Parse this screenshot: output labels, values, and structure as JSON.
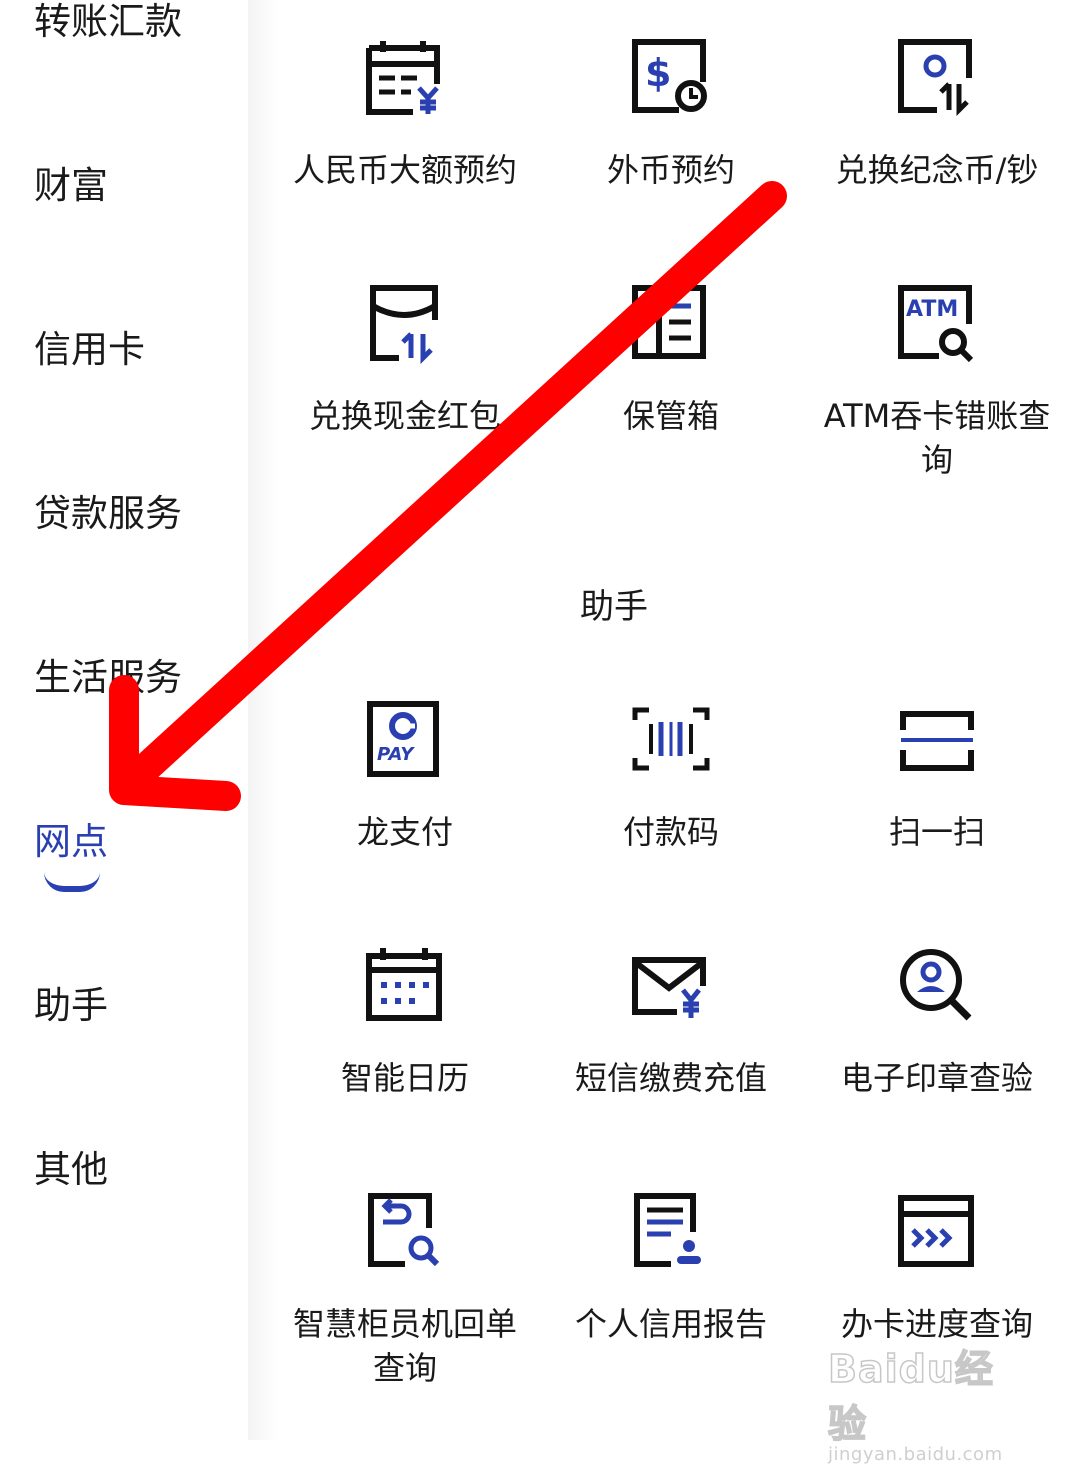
{
  "sidebar": {
    "items": [
      {
        "label": "转账汇款"
      },
      {
        "label": "财富"
      },
      {
        "label": "信用卡"
      },
      {
        "label": "贷款服务"
      },
      {
        "label": "生活服务"
      },
      {
        "label": "网点",
        "active": true
      },
      {
        "label": "助手"
      },
      {
        "label": "其他"
      }
    ]
  },
  "main": {
    "section_title": "助手",
    "tiles": [
      {
        "label": "人民币大额预约",
        "icon": "calendar-yuan-icon"
      },
      {
        "label": "外币预约",
        "icon": "dollar-clock-icon"
      },
      {
        "label": "兑换纪念币/钞",
        "icon": "coin-exchange-icon"
      },
      {
        "label": "兑换现金红包",
        "icon": "red-envelope-exchange-icon"
      },
      {
        "label": "保管箱",
        "icon": "safe-box-icon"
      },
      {
        "label": "ATM吞卡错账查询",
        "icon": "atm-search-icon"
      },
      {
        "label": "龙支付",
        "icon": "ccb-pay-icon"
      },
      {
        "label": "付款码",
        "icon": "barcode-icon"
      },
      {
        "label": "扫一扫",
        "icon": "scan-icon"
      },
      {
        "label": "智能日历",
        "icon": "calendar-icon"
      },
      {
        "label": "短信缴费充值",
        "icon": "mail-yuan-icon"
      },
      {
        "label": "电子印章查验",
        "icon": "seal-search-icon"
      },
      {
        "label": "智慧柜员机回单查询",
        "icon": "receipt-search-icon"
      },
      {
        "label": "个人信用报告",
        "icon": "credit-report-icon"
      },
      {
        "label": "办卡进度查询",
        "icon": "card-progress-icon"
      }
    ]
  },
  "watermark": {
    "text": "Baidu经验",
    "sub": "jingyan.baidu.com"
  },
  "colors": {
    "accent": "#2a3fb0",
    "icon_dark": "#111111",
    "arrow": "#ff0000"
  }
}
